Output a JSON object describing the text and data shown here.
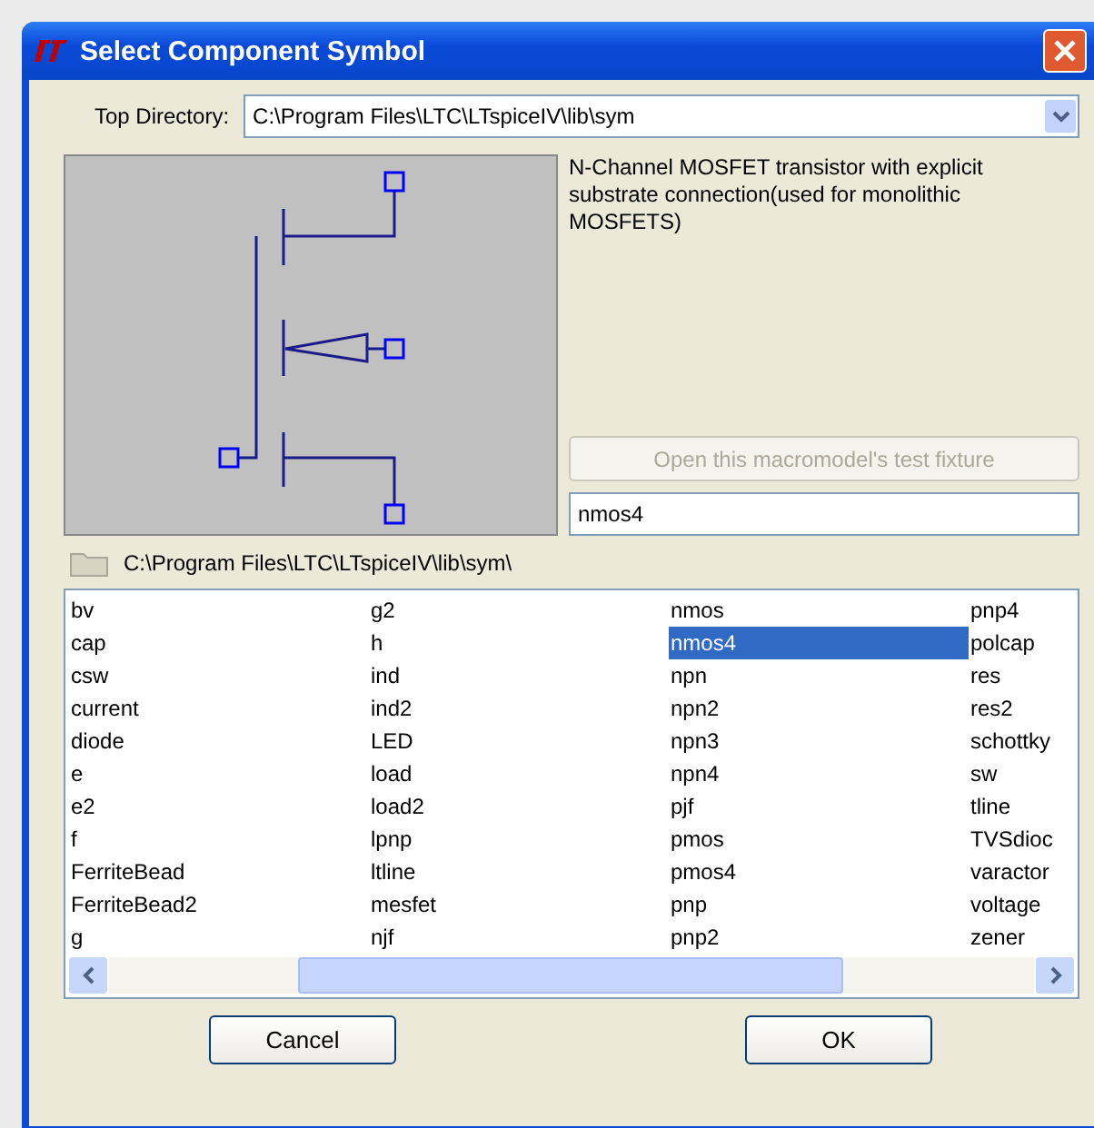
{
  "window": {
    "title": "Select Component Symbol"
  },
  "top_directory": {
    "label": "Top Directory:",
    "value": "C:\\Program Files\\LTC\\LTspiceIV\\lib\\sym"
  },
  "description": "N-Channel MOSFET transistor with explicit substrate connection(used for monolithic MOSFETS)",
  "test_fixture_button": {
    "label": "Open this macromodel's test fixture",
    "disabled": true
  },
  "name_field": {
    "value": "nmos4"
  },
  "current_path": "C:\\Program Files\\LTC\\LTspiceIV\\lib\\sym\\",
  "list": {
    "columns": [
      [
        {
          "label": "bv",
          "selected": false
        },
        {
          "label": "cap",
          "selected": false
        },
        {
          "label": "csw",
          "selected": false
        },
        {
          "label": "current",
          "selected": false
        },
        {
          "label": "diode",
          "selected": false
        },
        {
          "label": "e",
          "selected": false
        },
        {
          "label": "e2",
          "selected": false
        },
        {
          "label": "f",
          "selected": false
        },
        {
          "label": "FerriteBead",
          "selected": false
        },
        {
          "label": "FerriteBead2",
          "selected": false
        },
        {
          "label": "g",
          "selected": false
        }
      ],
      [
        {
          "label": "g2",
          "selected": false
        },
        {
          "label": "h",
          "selected": false
        },
        {
          "label": "ind",
          "selected": false
        },
        {
          "label": "ind2",
          "selected": false
        },
        {
          "label": "LED",
          "selected": false
        },
        {
          "label": "load",
          "selected": false
        },
        {
          "label": "load2",
          "selected": false
        },
        {
          "label": "lpnp",
          "selected": false
        },
        {
          "label": "ltline",
          "selected": false
        },
        {
          "label": "mesfet",
          "selected": false
        },
        {
          "label": "njf",
          "selected": false
        }
      ],
      [
        {
          "label": "nmos",
          "selected": false
        },
        {
          "label": "nmos4",
          "selected": true
        },
        {
          "label": "npn",
          "selected": false
        },
        {
          "label": "npn2",
          "selected": false
        },
        {
          "label": "npn3",
          "selected": false
        },
        {
          "label": "npn4",
          "selected": false
        },
        {
          "label": "pjf",
          "selected": false
        },
        {
          "label": "pmos",
          "selected": false
        },
        {
          "label": "pmos4",
          "selected": false
        },
        {
          "label": "pnp",
          "selected": false
        },
        {
          "label": "pnp2",
          "selected": false
        }
      ],
      [
        {
          "label": "pnp4",
          "selected": false
        },
        {
          "label": "polcap",
          "selected": false
        },
        {
          "label": "res",
          "selected": false
        },
        {
          "label": "res2",
          "selected": false
        },
        {
          "label": "schottky",
          "selected": false
        },
        {
          "label": "sw",
          "selected": false
        },
        {
          "label": "tline",
          "selected": false
        },
        {
          "label": "TVSdioc",
          "selected": false
        },
        {
          "label": "varactor",
          "selected": false
        },
        {
          "label": "voltage",
          "selected": false
        },
        {
          "label": "zener",
          "selected": false
        }
      ]
    ]
  },
  "buttons": [
    {
      "label": "Cancel"
    },
    {
      "label": "OK"
    }
  ]
}
